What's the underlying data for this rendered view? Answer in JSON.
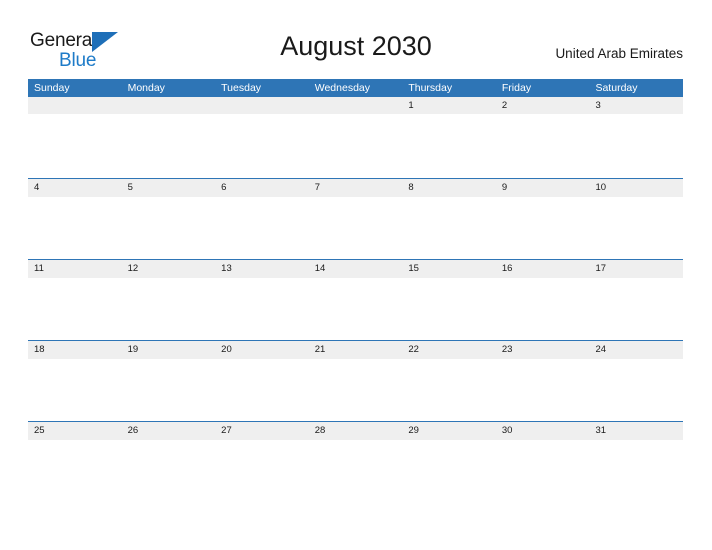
{
  "brand": {
    "name_part1": "General",
    "name_part2": "Blue",
    "flag_icon": "blue-triangle-flag-icon",
    "color_dark": "#1a1a1a",
    "color_blue": "#1e7bc8"
  },
  "header": {
    "title": "August 2030",
    "country": "United Arab Emirates"
  },
  "theme": {
    "header_blue": "#2e75b6",
    "band_gray": "#efefef",
    "text_dark": "#1a1a1a",
    "page_background": "#ffffff"
  },
  "calendar": {
    "month": "August",
    "year": "2030",
    "weekday_headers": [
      "Sunday",
      "Monday",
      "Tuesday",
      "Wednesday",
      "Thursday",
      "Friday",
      "Saturday"
    ],
    "weeks": [
      {
        "days": [
          "",
          "",
          "",
          "",
          "1",
          "2",
          "3"
        ]
      },
      {
        "days": [
          "4",
          "5",
          "6",
          "7",
          "8",
          "9",
          "10"
        ]
      },
      {
        "days": [
          "11",
          "12",
          "13",
          "14",
          "15",
          "16",
          "17"
        ]
      },
      {
        "days": [
          "18",
          "19",
          "20",
          "21",
          "22",
          "23",
          "24"
        ]
      },
      {
        "days": [
          "25",
          "26",
          "27",
          "28",
          "29",
          "30",
          "31"
        ]
      }
    ]
  }
}
